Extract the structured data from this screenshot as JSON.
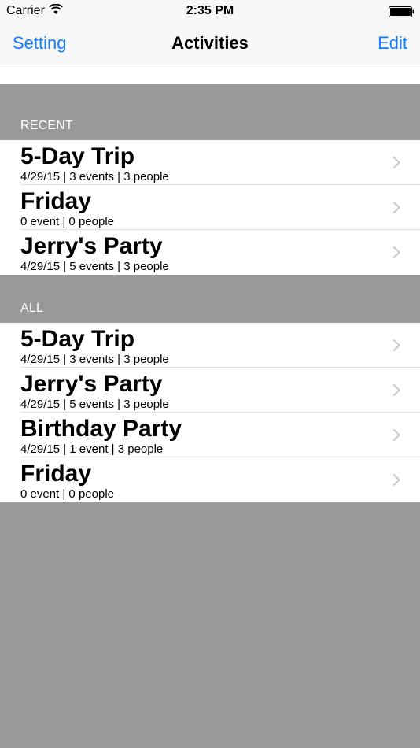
{
  "status_bar": {
    "carrier": "Carrier",
    "time": "2:35 PM"
  },
  "nav": {
    "left_button": "Setting",
    "title": "Activities",
    "right_button": "Edit"
  },
  "sections": [
    {
      "label": "RECENT",
      "rows": [
        {
          "title": "5-Day Trip",
          "detail": "4/29/15 | 3 events | 3 people"
        },
        {
          "title": "Friday",
          "detail": "0 event | 0 people"
        },
        {
          "title": "Jerry's Party",
          "detail": "4/29/15 | 5 events | 3 people"
        }
      ]
    },
    {
      "label": "ALL",
      "rows": [
        {
          "title": "5-Day Trip",
          "detail": "4/29/15 | 3 events | 3 people"
        },
        {
          "title": "Jerry's Party",
          "detail": "4/29/15 | 5 events | 3 people"
        },
        {
          "title": "Birthday Party",
          "detail": "4/29/15 | 1 event | 3 people"
        },
        {
          "title": "Friday",
          "detail": "0 event | 0 people"
        }
      ]
    }
  ],
  "colors": {
    "accent": "#147efb",
    "background": "#999999",
    "cell": "#ffffff"
  }
}
